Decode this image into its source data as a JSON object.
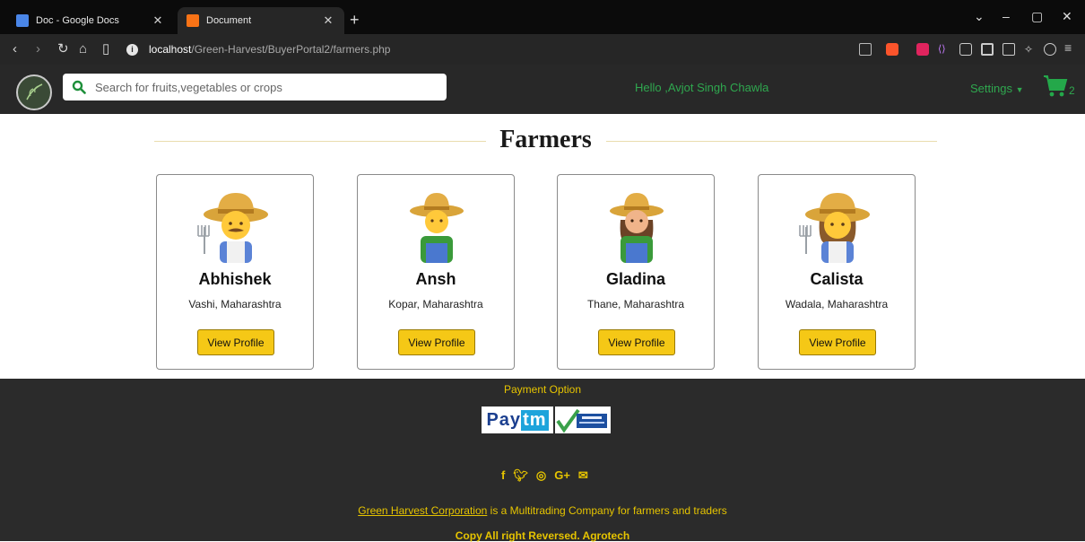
{
  "browser": {
    "tabs": [
      {
        "title": "Doc - Google Docs",
        "favicon_color": "#4a86e8",
        "active": false
      },
      {
        "title": "Document",
        "favicon_color": "#f97316",
        "active": true
      }
    ],
    "url_host": "localhost",
    "url_path": "/Green-Harvest/BuyerPortal2/farmers.php"
  },
  "header": {
    "search_placeholder": "Search for fruits,vegetables or crops",
    "greeting": "Hello ,Avjot Singh Chawla",
    "settings_label": "Settings",
    "cart_count": "2",
    "accent_color": "#2fa84f"
  },
  "main": {
    "title": "Farmers",
    "farmers": [
      {
        "name": "Abhishek",
        "location": "Vashi, Maharashtra",
        "button": "View Profile",
        "avatar": "male-farmer-with-pitchfork"
      },
      {
        "name": "Ansh",
        "location": "Kopar, Maharashtra",
        "button": "View Profile",
        "avatar": "young-male-farmer"
      },
      {
        "name": "Gladina",
        "location": "Thane, Maharashtra",
        "button": "View Profile",
        "avatar": "female-farmer"
      },
      {
        "name": "Calista",
        "location": "Wadala, Maharashtra",
        "button": "View Profile",
        "avatar": "female-farmer-with-pitchfork"
      }
    ]
  },
  "footer": {
    "payment_title": "Payment Option",
    "payment_methods": [
      "Paytm",
      "COD"
    ],
    "paytm_label_a": "Pay",
    "paytm_label_b": "tm",
    "social_icons": [
      "facebook-icon",
      "twitter-icon",
      "instagram-icon",
      "google-plus-icon",
      "mail-icon"
    ],
    "company_link": "Green Harvest Corporation",
    "company_text": " is a Multitrading Company for farmers and traders",
    "copyright": "Copy All right Reversed.  Agrotech",
    "accent_color": "#e6c400"
  }
}
